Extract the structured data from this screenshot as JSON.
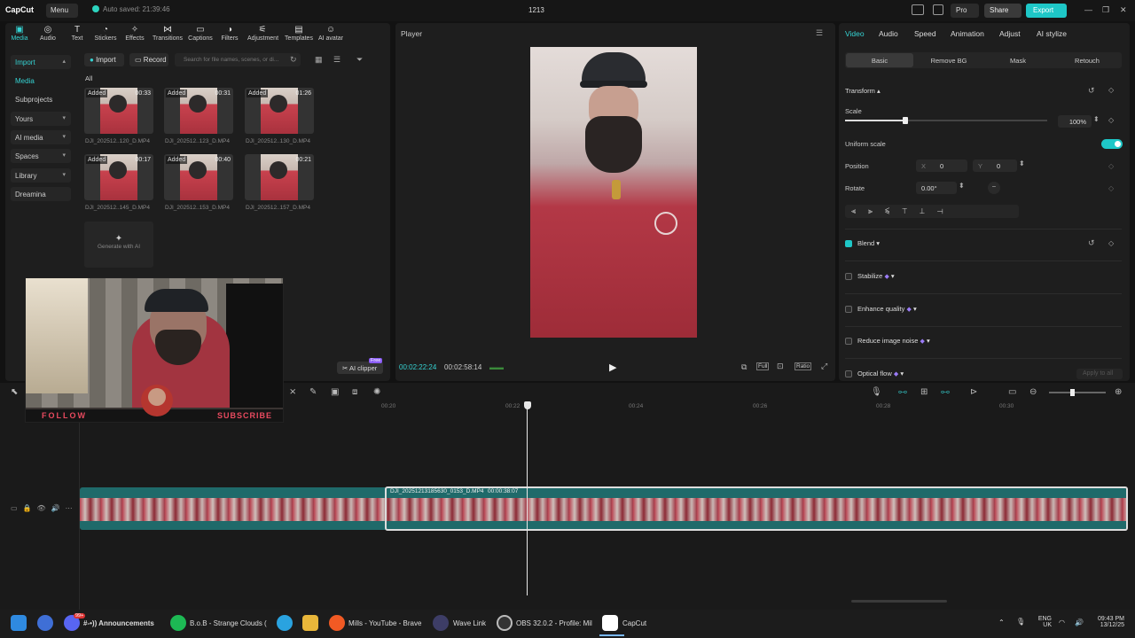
{
  "app": {
    "name": "CapCut",
    "menu_label": "Menu",
    "autosave": "Auto saved: 21:39:46",
    "project_title": "1213",
    "pro_label": "Pro",
    "share_label": "Share",
    "export_label": "Export"
  },
  "toolbar": [
    "Media",
    "Audio",
    "Text",
    "Stickers",
    "Effects",
    "Transitions",
    "Captions",
    "Filters",
    "Adjustment",
    "Templates",
    "AI avatar"
  ],
  "sidebar": [
    "Import",
    "Media",
    "Subprojects",
    "Yours",
    "AI media",
    "Spaces",
    "Library",
    "Dreamina"
  ],
  "media": {
    "import_label": "Import",
    "record_label": "Record",
    "search_placeholder": "Search for file names, scenes, or di...",
    "filter_label": "All",
    "items": [
      {
        "added": "Added",
        "duration": "00:33",
        "name": "DJI_202512..120_D.MP4"
      },
      {
        "added": "Added",
        "duration": "00:31",
        "name": "DJI_202512..123_D.MP4"
      },
      {
        "added": "Added",
        "duration": "01:26",
        "name": "DJI_202512..130_D.MP4"
      },
      {
        "added": "Added",
        "duration": "00:17",
        "name": "DJI_202512..145_D.MP4"
      },
      {
        "added": "Added",
        "duration": "00:40",
        "name": "DJI_202512..153_D.MP4"
      },
      {
        "added": "",
        "duration": "00:21",
        "name": "DJI_202512..157_D.MP4"
      }
    ],
    "generate_ai": "Generate with AI",
    "ai_clipper": "AI clipper",
    "ai_clipper_badge": "Free"
  },
  "player": {
    "title": "Player",
    "current_time": "00:02:22:24",
    "total_time": "00:02:58:14",
    "full_label": "Full",
    "ratio_label": "Ratio"
  },
  "properties": {
    "tabs": [
      "Video",
      "Audio",
      "Speed",
      "Animation",
      "Adjust",
      "AI stylize"
    ],
    "subtabs": [
      "Basic",
      "Remove BG",
      "Mask",
      "Retouch"
    ],
    "transform": "Transform",
    "scale_label": "Scale",
    "scale_value": "100%",
    "scale_fraction": 0.3,
    "uniform_scale": "Uniform scale",
    "position_label": "Position",
    "pos_x_label": "X",
    "pos_x": "0",
    "pos_y_label": "Y",
    "pos_y": "0",
    "rotate_label": "Rotate",
    "rotate_value": "0.00°",
    "blend": "Blend",
    "stabilize": "Stabilize",
    "enhance_quality": "Enhance quality",
    "reduce_noise": "Reduce image noise",
    "optical_flow": "Optical flow",
    "apply_all": "Apply to all"
  },
  "timeline": {
    "ruler": [
      "00:20",
      "00:22",
      "00:24",
      "00:26",
      "00:28",
      "00:30"
    ],
    "clip_name": "DJI_20251213185630_0153_D.MP4",
    "clip_duration": "00:00:38:07"
  },
  "webcam": {
    "follow": "FOLLOW",
    "subscribe": "SUBSCRIBE"
  },
  "taskbar": {
    "apps": [
      "#-•)) Announcements",
      "B.o.B - Strange Clouds (",
      "Mills - YouTube - Brave",
      "Wave Link",
      "OBS 32.0.2 - Profile: Mil",
      "CapCut"
    ],
    "discord_badge": "99+",
    "lang": "ENG",
    "region": "UK",
    "time": "09:43 PM",
    "date": "13/12/25"
  },
  "colors": {
    "accent": "#1ec7c7",
    "clip": "#1f6a6a",
    "badge": "#9b7cf7"
  }
}
